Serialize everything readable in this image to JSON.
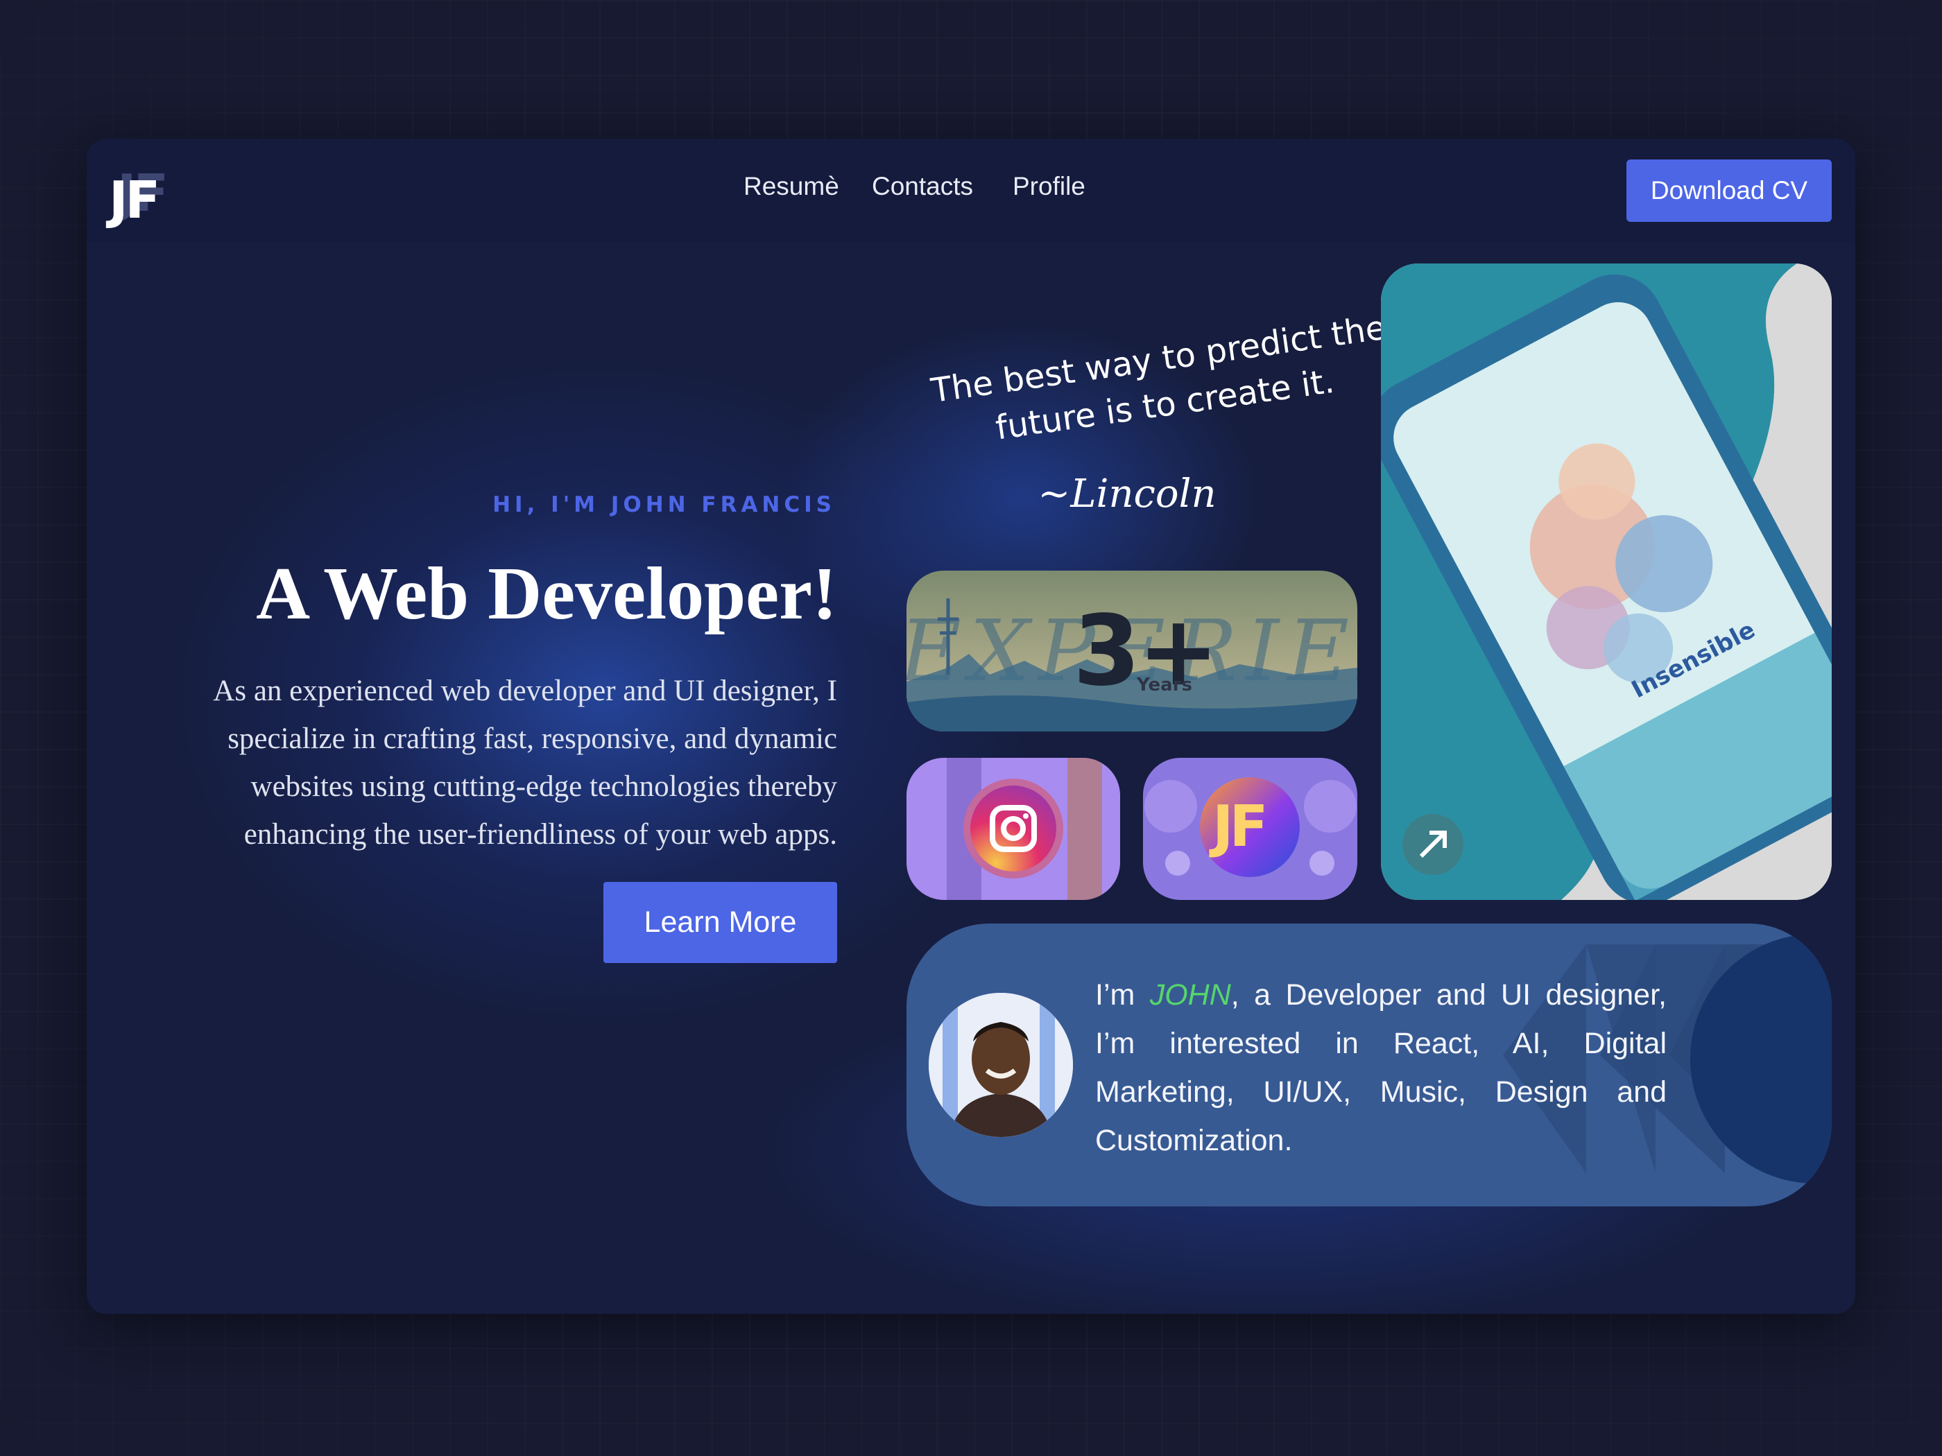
{
  "brand": {
    "logo_text": "JF"
  },
  "nav": {
    "links": [
      "Resumè",
      "Contacts",
      "Profile"
    ],
    "download_cv": "Download CV"
  },
  "hero": {
    "greeting": "HI, I'M JOHN FRANCIS",
    "headline": "A Web Developer!",
    "intro": "As an experienced web developer and UI designer, I specialize in crafting fast, responsive, and dynamic websites using cutting-edge technologies thereby enhancing the user-friendliness of your web apps.",
    "cta": "Learn More"
  },
  "quote": {
    "text": "The best way to predict the future is to create it.",
    "author": "~Lincoln"
  },
  "experience_card": {
    "bg_text": "EXPERIENCE",
    "number": "3+",
    "unit": "Years"
  },
  "social_cards": {
    "instagram_icon": "instagram-icon",
    "jf_logo": "JF"
  },
  "phone_card": {
    "app_title": "Insensible",
    "arrow_icon": "arrow-up-right-icon"
  },
  "bio": {
    "prefix": "I’m ",
    "name": "JOHN",
    "rest": ", a Developer and UI designer, I’m interested in React, AI, Digital Marketing, UI/UX, Music, Design and Customization."
  },
  "colors": {
    "accent": "#4d66e6",
    "name_highlight": "#56d66b",
    "bio_card": "#385a93",
    "background": "#161d3e"
  }
}
